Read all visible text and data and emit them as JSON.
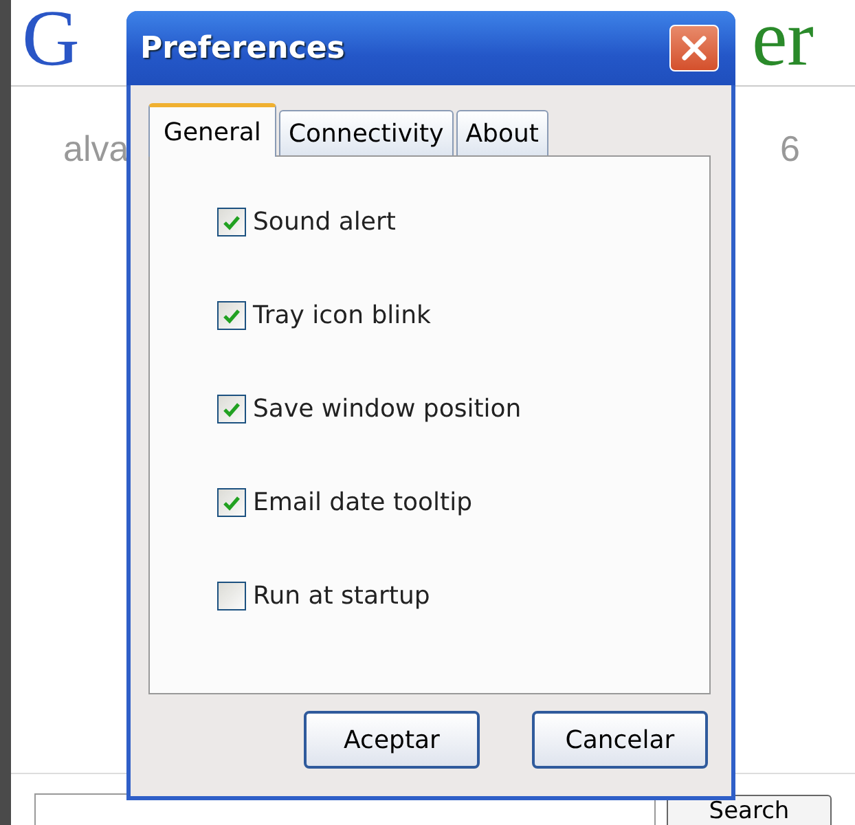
{
  "background_window": {
    "logo": {
      "left": "G",
      "right": "er"
    },
    "account": "alva",
    "count": "6",
    "search_button": "Search"
  },
  "dialog": {
    "title": "Preferences",
    "tabs": [
      {
        "label": "General",
        "selected": true
      },
      {
        "label": "Connectivity",
        "selected": false
      },
      {
        "label": "About",
        "selected": false
      }
    ],
    "options": [
      {
        "label": "Sound alert",
        "checked": true
      },
      {
        "label": "Tray icon blink",
        "checked": true
      },
      {
        "label": "Save window position",
        "checked": true
      },
      {
        "label": "Email date tooltip",
        "checked": true
      },
      {
        "label": "Run at startup",
        "checked": false
      }
    ],
    "buttons": [
      "Aceptar",
      "Cancelar"
    ]
  }
}
